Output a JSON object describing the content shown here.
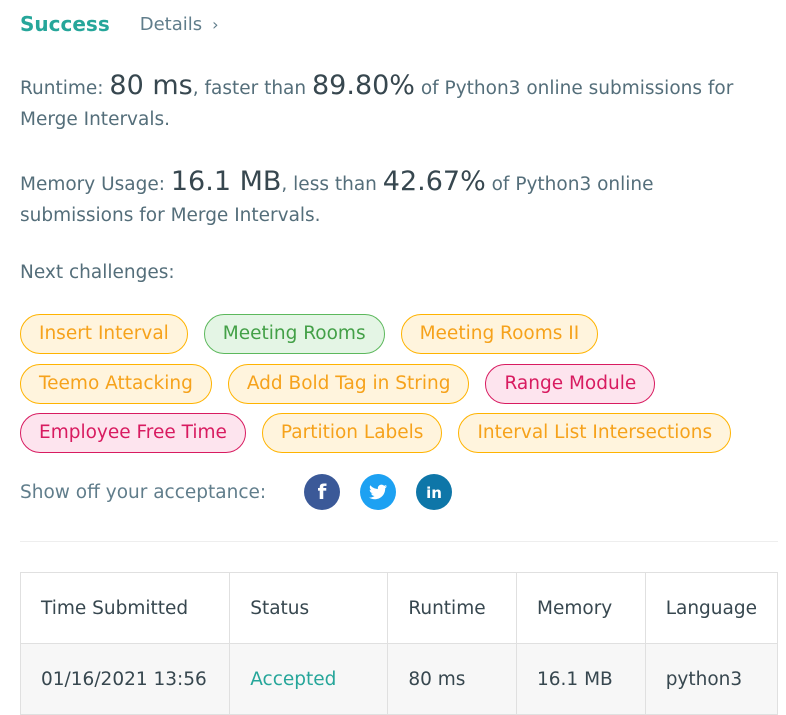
{
  "header": {
    "status": "Success",
    "details_label": "Details",
    "details_chevron": "›"
  },
  "runtime_stat": {
    "label": "Runtime: ",
    "value": "80 ms",
    "middle": ", faster than ",
    "percent": "89.80%",
    "suffix": " of Python3 online submissions for Merge Intervals."
  },
  "memory_stat": {
    "label": "Memory Usage: ",
    "value": "16.1 MB",
    "middle": ", less than ",
    "percent": "42.67%",
    "suffix": " of Python3 online submissions for Merge Intervals."
  },
  "next_challenges": {
    "label": "Next challenges:",
    "tags": [
      {
        "label": "Insert Interval",
        "difficulty": "easy"
      },
      {
        "label": "Meeting Rooms",
        "difficulty": "medium"
      },
      {
        "label": "Meeting Rooms II",
        "difficulty": "easy"
      },
      {
        "label": "Teemo Attacking",
        "difficulty": "easy"
      },
      {
        "label": "Add Bold Tag in String",
        "difficulty": "easy"
      },
      {
        "label": "Range Module",
        "difficulty": "hard"
      },
      {
        "label": "Employee Free Time",
        "difficulty": "hard"
      },
      {
        "label": "Partition Labels",
        "difficulty": "easy"
      },
      {
        "label": "Interval List Intersections",
        "difficulty": "easy"
      }
    ]
  },
  "share": {
    "label": "Show off your acceptance:",
    "icons": [
      "facebook-icon",
      "twitter-icon",
      "linkedin-icon"
    ]
  },
  "submissions_table": {
    "headers": [
      "Time Submitted",
      "Status",
      "Runtime",
      "Memory",
      "Language"
    ],
    "rows": [
      {
        "time": "01/16/2021 13:56",
        "status": "Accepted",
        "runtime": "80 ms",
        "memory": "16.1 MB",
        "language": "python3"
      }
    ]
  },
  "colors": {
    "success": "#26a69a",
    "easy": "#f6a21b",
    "medium": "#43a047",
    "hard": "#d81b60",
    "facebook": "#3b5998",
    "twitter": "#1da1f2",
    "linkedin": "#0e76a8"
  }
}
